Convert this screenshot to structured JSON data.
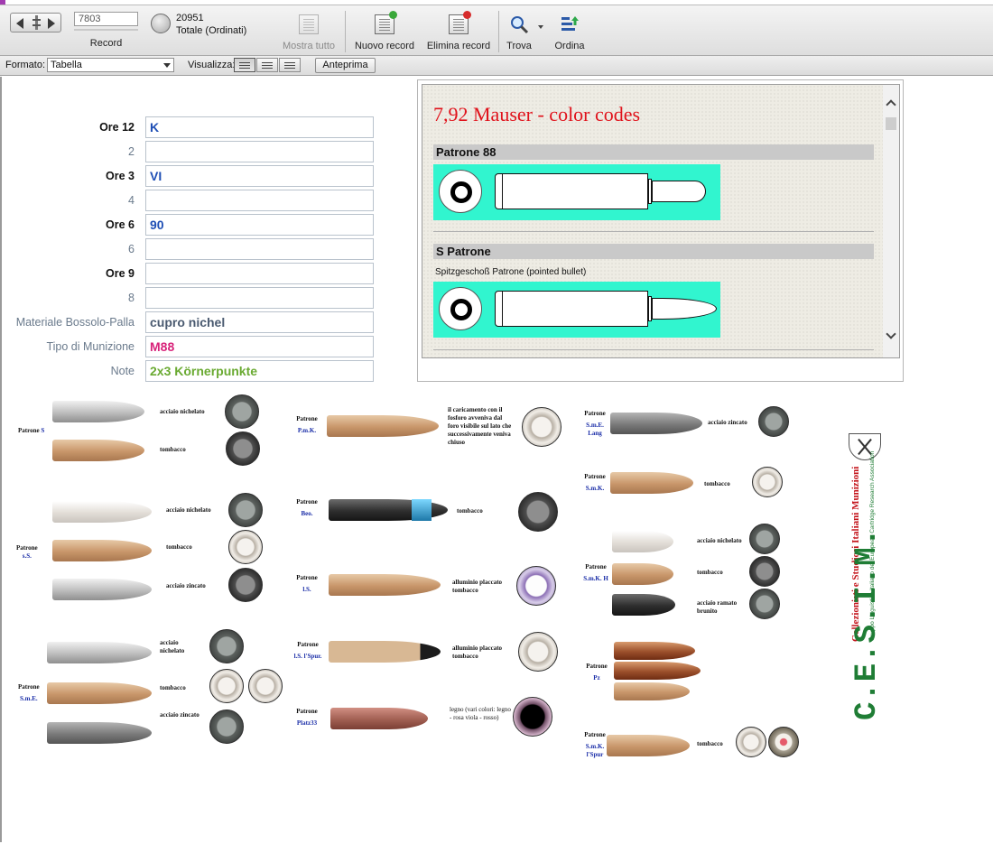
{
  "toolbar": {
    "record_value": "7803",
    "record_label": "Record",
    "total_count": "20951",
    "total_label": "Totale (Ordinati)",
    "show_all": "Mostra tutto",
    "new_record": "Nuovo record",
    "delete_record": "Elimina record",
    "find": "Trova",
    "sort": "Ordina"
  },
  "formatbar": {
    "format_label": "Formato:",
    "format_value": "Tabella",
    "view_label": "Visualizza:",
    "preview": "Anteprima"
  },
  "form": [
    {
      "label": "Ore 12",
      "value": "K",
      "style": "bold",
      "color": "blue"
    },
    {
      "label": "2",
      "value": "",
      "style": "dim",
      "color": "blue"
    },
    {
      "label": "Ore 3",
      "value": "VI",
      "style": "bold",
      "color": "blue"
    },
    {
      "label": "4",
      "value": "",
      "style": "dim",
      "color": "blue"
    },
    {
      "label": "Ore 6",
      "value": "90",
      "style": "bold",
      "color": "blue"
    },
    {
      "label": "6",
      "value": "",
      "style": "dim",
      "color": "blue"
    },
    {
      "label": "Ore 9",
      "value": "",
      "style": "bold",
      "color": "blue"
    },
    {
      "label": "8",
      "value": "",
      "style": "dim",
      "color": "blue"
    },
    {
      "label": "Materiale Bossolo-Palla",
      "value": "cupro nichel",
      "style": "dim",
      "color": "slate"
    },
    {
      "label": "Tipo di Munizione",
      "value": "M88",
      "style": "dim",
      "color": "pink"
    },
    {
      "label": "Note",
      "value": "2x3 Körnerpunkte",
      "style": "dim",
      "color": "green"
    }
  ],
  "webviewer": {
    "title": "7,92 Mauser - color codes",
    "sections": [
      {
        "name": "Patrone 88",
        "subtitle": ""
      },
      {
        "name": "S Patrone",
        "subtitle": "Spitzgeschoß Patrone (pointed bullet)"
      }
    ],
    "cartridge_color": "#31f5cf"
  },
  "chart": {
    "col1": {
      "groups": [
        {
          "label": "Patrone",
          "name": "S",
          "rows": [
            "acciaio nichelato",
            "tombacco"
          ]
        },
        {
          "label": "Patrone",
          "name": "s.S.",
          "rows": [
            "acciaio nichelato",
            "tombacco",
            "acciaio zincato"
          ]
        },
        {
          "label": "Patrone",
          "name": "S.m.E.",
          "rows": [
            "acciaio nichelato",
            "tombacco",
            "acciaio zincato"
          ]
        }
      ]
    },
    "col2": {
      "groups": [
        {
          "label": "Patrone",
          "name": "P.m.K.",
          "rows": [
            "il caricamento con il fosforo avveniva dal foro visibile sul lato che successivamente veniva chiuso"
          ]
        },
        {
          "label": "Patrone",
          "name": "Beo.",
          "rows": [
            "tombacco"
          ]
        },
        {
          "label": "Patrone",
          "name": "l.S.",
          "rows": [
            "alluminio placcato tombacco"
          ]
        },
        {
          "label": "Patrone",
          "name": "l.S. l'Spur.",
          "rows": [
            "alluminio placcato tombacco"
          ]
        },
        {
          "label": "Patrone",
          "name": "Platz33",
          "rows": [
            "legno (vari colori: legno - rosa viola - rosso)"
          ]
        }
      ]
    },
    "col3": {
      "groups": [
        {
          "label": "Patrone",
          "name": "S.m.E. Lang",
          "rows": [
            "acciaio zincato"
          ]
        },
        {
          "label": "Patrone",
          "name": "S.m.K.",
          "rows": [
            "tombacco"
          ]
        },
        {
          "label": "Patrone",
          "name": "S.m.K. H",
          "rows": [
            "acciaio nichelato",
            "tombacco",
            "acciaio ramato brunito"
          ]
        },
        {
          "label": "Patrone",
          "name": "Pz",
          "rows": []
        },
        {
          "label": "Patrone",
          "name": "S.m.K. l'Spur",
          "rows": [
            "tombacco"
          ]
        }
      ]
    }
  },
  "logo": {
    "acronym": "C.E.S.I.M.",
    "line1": "Collezionisti e Studiosi Italiani Munizioni",
    "line2": "Gruppo Linguistico Italiano del European Cartridge Research Association"
  }
}
